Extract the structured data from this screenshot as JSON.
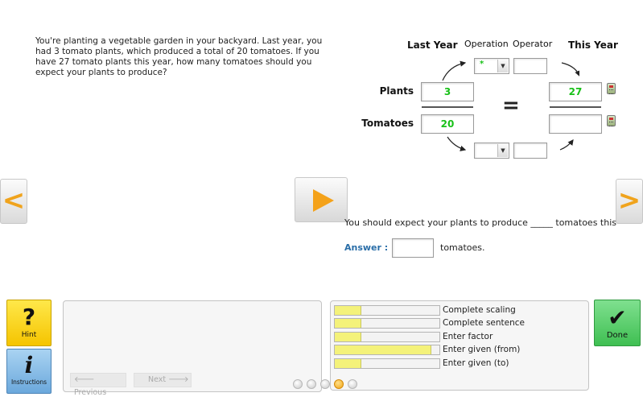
{
  "problem": {
    "text": "You're planting a vegetable garden in your backyard. Last year, you had 3 tomato plants, which produced a total of 20 tomatoes. If you have 27 tomato plants this year, how many tomatoes should you expect your plants to produce?"
  },
  "table": {
    "header_last_year": "Last Year",
    "header_operation": "Operation",
    "header_operator": "Operator",
    "header_this_year": "This Year",
    "row_plants_label": "Plants",
    "row_tomatoes_label": "Tomatoes",
    "plants_last_year": "3",
    "plants_this_year": "27",
    "tomatoes_last_year": "20",
    "tomatoes_this_year": "",
    "equals_sign": "=",
    "top_operation_value": "*",
    "top_operator_value": "",
    "bottom_operation_value": "",
    "bottom_operator_value": ""
  },
  "sentence": {
    "text": "You should expect your plants to produce _____ tomatoes this"
  },
  "answer": {
    "label": "Answer :",
    "value": "",
    "unit": "tomatoes."
  },
  "navigation": {
    "left_arrow": "<",
    "right_arrow": ">"
  },
  "sidebar": {
    "hint_glyph": "?",
    "hint_label": "Hint",
    "instructions_glyph": "i",
    "instructions_label": "Instructions"
  },
  "hint_panel": {
    "previous_label": "Previous",
    "next_label": "Next",
    "previous_arrow": "🡐",
    "next_arrow": "🡒"
  },
  "skills": [
    {
      "label": "Complete scaling",
      "progress": 0.25
    },
    {
      "label": "Complete sentence",
      "progress": 0.25
    },
    {
      "label": "Enter factor",
      "progress": 0.25
    },
    {
      "label": "Enter given (from)",
      "progress": 0.92
    },
    {
      "label": "Enter given (to)",
      "progress": 0.25
    }
  ],
  "done": {
    "glyph": "✔",
    "label": "Done"
  },
  "pagination": {
    "total": 5,
    "active_index": 3
  },
  "colors": {
    "accent_orange": "#f4a21a",
    "value_green": "#18c018",
    "hint_yellow": "#f5c400",
    "done_green": "#3fbf52",
    "instructions_blue": "#6ba8dc",
    "skill_fill": "#f4f27a",
    "answer_label_blue": "#2a6ea8"
  }
}
